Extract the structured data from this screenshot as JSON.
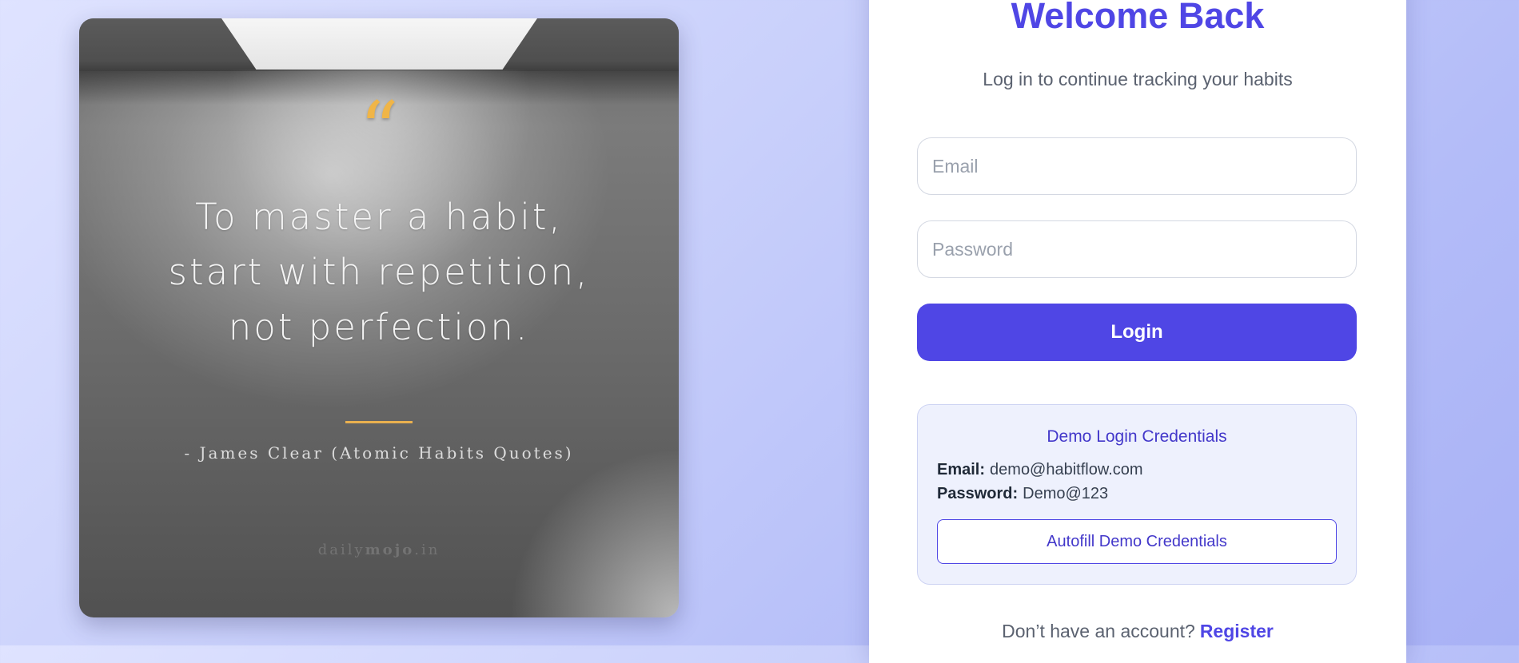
{
  "quote_card": {
    "quote_mark": "“",
    "quote_lines": [
      "To master a habit,",
      "start with repetition,",
      "not perfection."
    ],
    "author": "- James Clear (Atomic Habits Quotes)",
    "watermark_prefix": "daily",
    "watermark_brand": "mojo",
    "watermark_suffix": ".in"
  },
  "login": {
    "title": "Welcome Back",
    "subtitle": "Log in to continue tracking your habits",
    "email_placeholder": "Email",
    "email_value": "",
    "password_placeholder": "Password",
    "password_value": "",
    "login_button_label": "Login",
    "demo": {
      "title": "Demo Login Credentials",
      "email_label": "Email:",
      "email_value": "demo@habitflow.com",
      "password_label": "Password:",
      "password_value": "Demo@123",
      "autofill_label": "Autofill Demo Credentials"
    },
    "register_prompt": "Don’t have an account?",
    "register_link": "Register"
  },
  "colors": {
    "accent": "#4f46e5",
    "quote_gold": "#f0b547"
  }
}
